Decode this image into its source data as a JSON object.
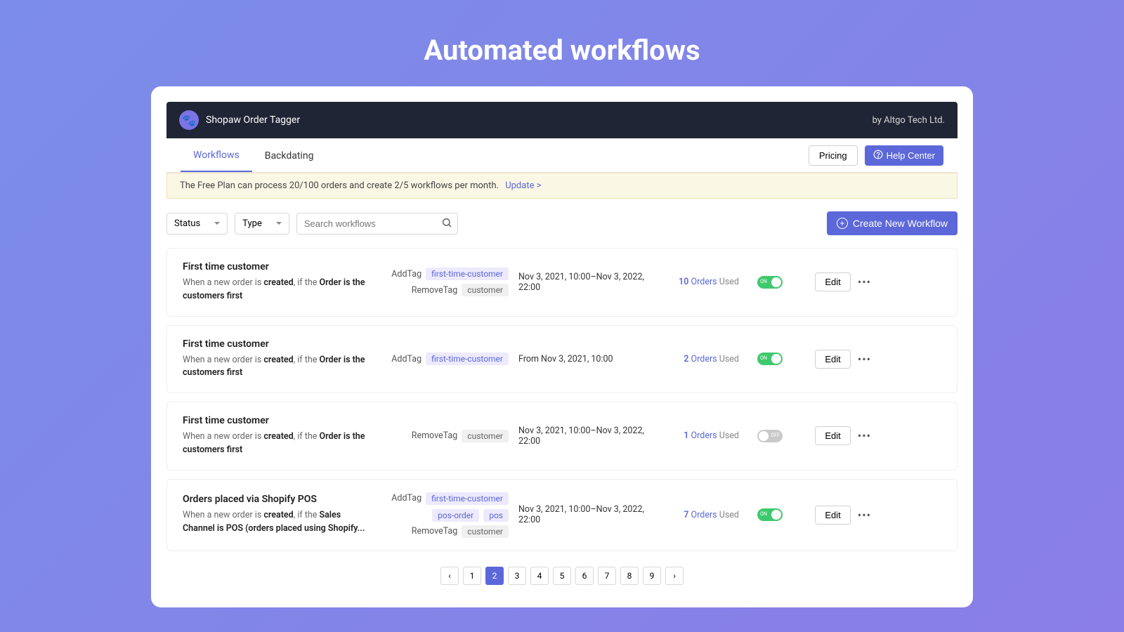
{
  "page_title": "Automated workflows",
  "header": {
    "app_name": "Shopaw Order Tagger",
    "by_line": "by Altgo Tech Ltd."
  },
  "tabs": {
    "workflows": "Workflows",
    "backdating": "Backdating"
  },
  "topbar": {
    "pricing": "Pricing",
    "help": "Help Center"
  },
  "notice": {
    "text": "The Free Plan can process 20/100 orders and create 2/5 workflows per month.",
    "update_link": "Update >"
  },
  "controls": {
    "status": "Status",
    "type": "Type",
    "search_placeholder": "Search workflows",
    "create": "Create New Workflow"
  },
  "labels": {
    "add_tag": "AddTag",
    "remove_tag": "RemoveTag",
    "orders": "Orders",
    "used": "Used",
    "on": "ON",
    "off": "OFF",
    "edit": "Edit"
  },
  "rows": [
    {
      "title": "First time customer",
      "desc_pre": "When a new order is ",
      "desc_bold1": "created",
      "desc_mid": ", if the ",
      "desc_bold2": "Order is the customers first",
      "add_tags": [
        "first-time-customer"
      ],
      "remove_tags": [
        "customer"
      ],
      "date": "Nov 3, 2021, 10:00–Nov 3, 2022, 22:00",
      "usage_num": "10",
      "toggle_on": true
    },
    {
      "title": "First time customer",
      "desc_pre": "When a new order is ",
      "desc_bold1": "created",
      "desc_mid": ", if the ",
      "desc_bold2": "Order is the customers first",
      "add_tags": [
        "first-time-customer"
      ],
      "remove_tags": [],
      "date": "From Nov 3, 2021, 10:00",
      "usage_num": "2",
      "toggle_on": true
    },
    {
      "title": "First time customer",
      "desc_pre": "When a new order is ",
      "desc_bold1": "created",
      "desc_mid": ", if the ",
      "desc_bold2": "Order is the customers first",
      "add_tags": [],
      "remove_tags": [
        "customer"
      ],
      "date": "Nov 3, 2021, 10:00–Nov 3, 2022, 22:00",
      "usage_num": "1",
      "toggle_on": false
    },
    {
      "title": "Orders placed via Shopify POS",
      "desc_pre": "When a new order is ",
      "desc_bold1": "created",
      "desc_mid": ", if the ",
      "desc_bold2": "Sales Channel is POS (orders placed using Shopify...",
      "add_tags": [
        "first-time-customer",
        "pos-order",
        "pos"
      ],
      "remove_tags": [
        "customer"
      ],
      "date": "Nov 3, 2021, 10:00–Nov 3, 2022, 22:00",
      "usage_num": "7",
      "toggle_on": true
    }
  ],
  "pager": {
    "pages": [
      "1",
      "2",
      "3",
      "4",
      "5",
      "6",
      "7",
      "8",
      "9"
    ],
    "active": "2"
  }
}
